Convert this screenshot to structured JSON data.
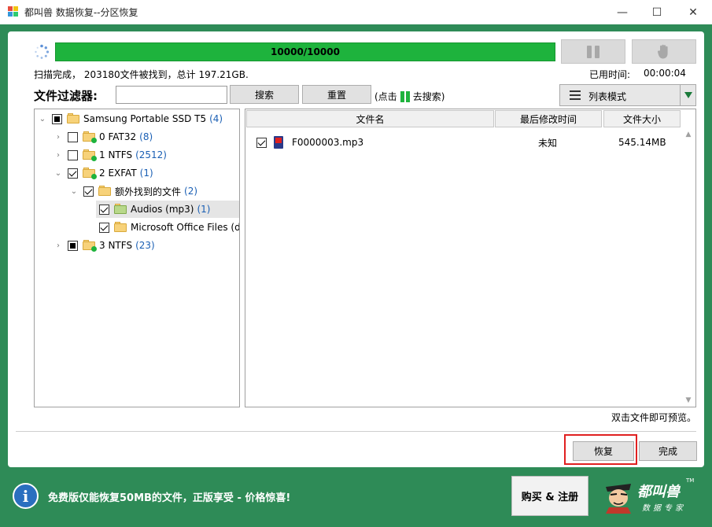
{
  "window": {
    "title": "都叫兽 数据恢复--分区恢复",
    "minimize": "—",
    "maximize": "☐",
    "close": "✕"
  },
  "scan": {
    "progress_text": "10000/10000",
    "progress_fraction": 1.0,
    "status": "扫描完成， 203180文件被找到，总计 197.21GB.",
    "elapsed_label": "已用时间:",
    "elapsed_value": "00:00:04"
  },
  "filter": {
    "label": "文件过滤器:",
    "input_value": "",
    "search_label": "搜索",
    "reset_label": "重置",
    "hint_before": "(点击",
    "hint_after": "去搜索)"
  },
  "view_mode": {
    "label": "列表模式"
  },
  "tree": {
    "nodes": [
      {
        "label": "Samsung Portable SSD T5",
        "count": "(4)"
      },
      {
        "label": "0 FAT32",
        "count": "(8)"
      },
      {
        "label": "1 NTFS",
        "count": "(2512)"
      },
      {
        "label": "2 EXFAT",
        "count": "(1)"
      },
      {
        "label": "额外找到的文件",
        "count": "(2)"
      },
      {
        "label": "Audios (mp3)",
        "count": "(1)"
      },
      {
        "label": "Microsoft Office Files (d",
        "count": ""
      },
      {
        "label": "3 NTFS",
        "count": "(23)"
      }
    ]
  },
  "file_list": {
    "columns": [
      "文件名",
      "最后修改时间",
      "文件大小"
    ],
    "rows": [
      {
        "name": "F0000003.mp3",
        "modified": "未知",
        "size": "545.14MB"
      }
    ]
  },
  "preview_hint": "双击文件即可预览。",
  "actions": {
    "recover_label": "恢复",
    "finish_label": "完成"
  },
  "footer": {
    "promo": "免费版仅能恢复50MB的文件，正版享受 - 价格惊喜!",
    "buy_label": "购买 & 注册",
    "logo_name": "都叫兽",
    "logo_sub": "数据专家",
    "logo_tm": "TM"
  }
}
